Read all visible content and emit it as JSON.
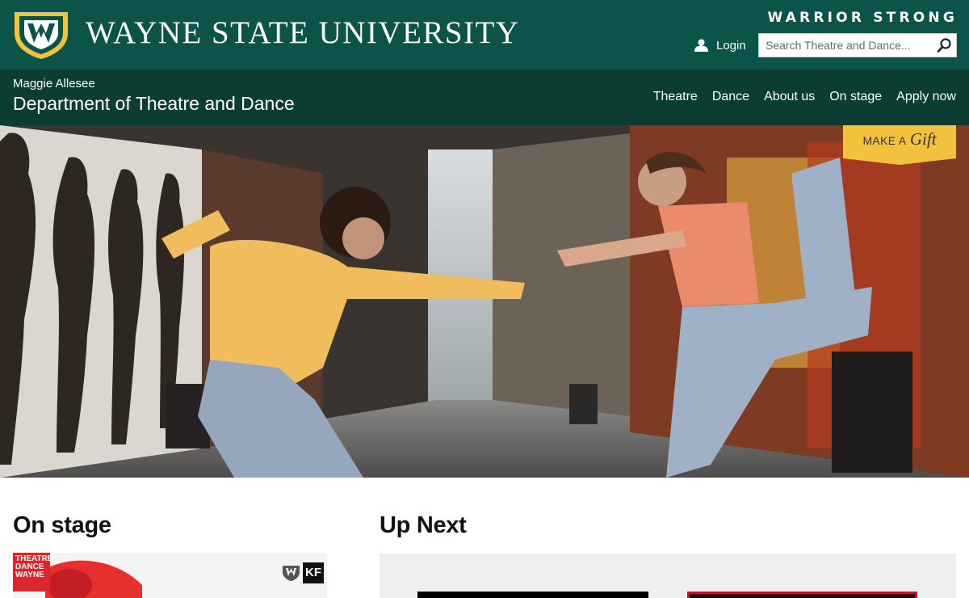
{
  "header": {
    "university_name": "WAYNE STATE UNIVERSITY",
    "tagline": "WARRIOR STRONG",
    "login_label": "Login",
    "search_placeholder": "Search Theatre and Dance..."
  },
  "department": {
    "subtitle": "Maggie Allesee",
    "title": "Department of Theatre and Dance"
  },
  "nav": {
    "items": [
      {
        "label": "Theatre"
      },
      {
        "label": "Dance"
      },
      {
        "label": "About us"
      },
      {
        "label": "On stage"
      },
      {
        "label": "Apply now"
      }
    ]
  },
  "gift_button": {
    "make_a": "MAKE A",
    "gift": "Gift"
  },
  "on_stage": {
    "heading": "On stage",
    "card_logo_text": "THEATRE DANCE WAYNE",
    "badge_text": "KF"
  },
  "up_next": {
    "heading": "Up Next"
  },
  "colors": {
    "header_green": "#0c5449",
    "dept_green": "#0b3d33",
    "gold": "#f2c23d"
  }
}
